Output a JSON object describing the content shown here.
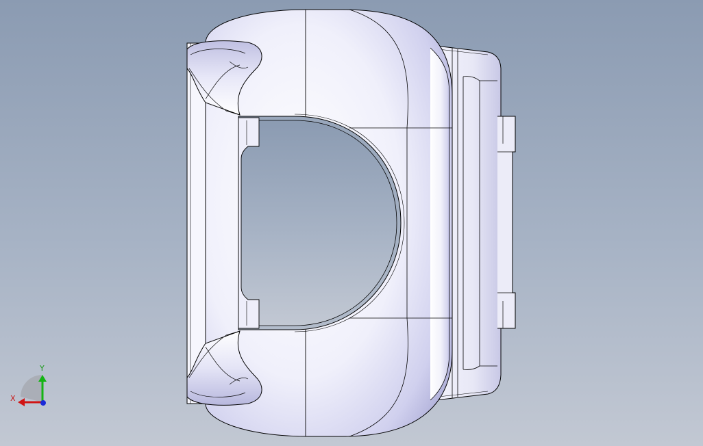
{
  "viewport": {
    "background_top": "#8b9bb2",
    "background_bottom": "#c2c8d3"
  },
  "model": {
    "name": "part-model",
    "shading_light": "#ffffff",
    "shading_mid": "#dcdcf4",
    "shading_dark": "#aeaed8",
    "edge_color": "#000000"
  },
  "triad": {
    "x_label": "X",
    "y_label": "Y",
    "x_color": "#d01414",
    "y_color": "#14b414",
    "z_color": "#1a2ad8"
  }
}
